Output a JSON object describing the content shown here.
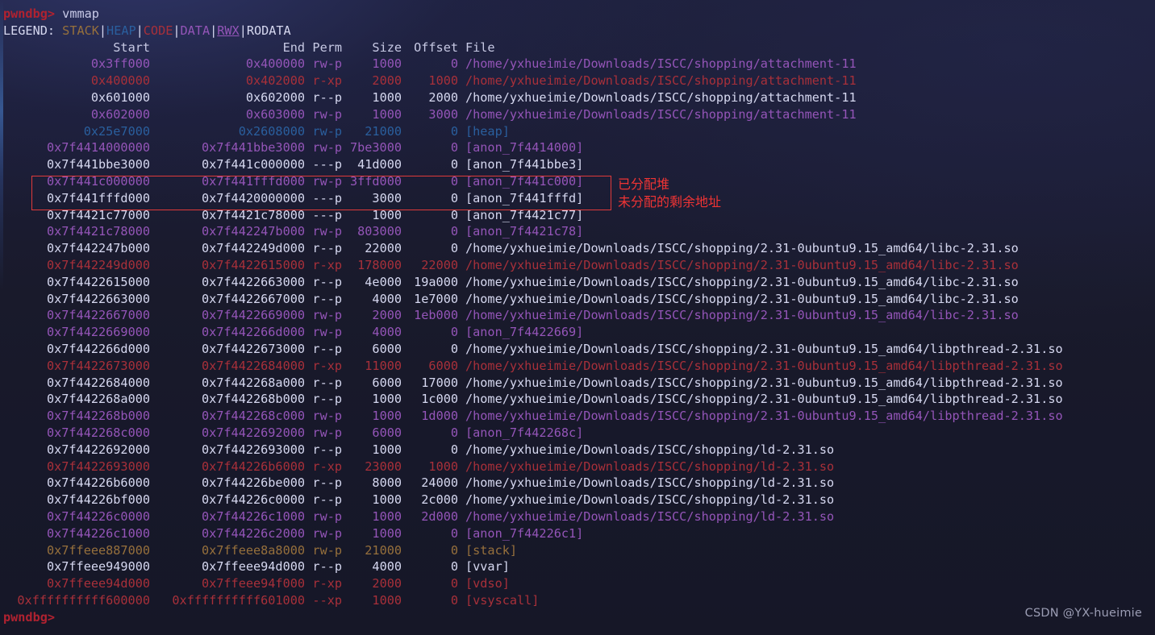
{
  "terminal": {
    "prompt": "pwndbg>",
    "command": "vmmap",
    "trailing_prompt": "pwndbg>",
    "legend": {
      "label": "LEGEND:",
      "items": [
        "STACK",
        "HEAP",
        "CODE",
        "DATA",
        "RWX",
        "RODATA"
      ],
      "separator": "|",
      "colors": {
        "STACK": "#96703c",
        "HEAP": "#2a5f9e",
        "CODE": "#a8303a",
        "DATA": "#9455b8",
        "RWX": "#9455b8",
        "RODATA": "#d6d8f0"
      }
    },
    "headers": {
      "start": "Start",
      "end": "End",
      "perm": "Perm",
      "size": "Size",
      "offset": "Offset",
      "file": "File"
    },
    "rows": [
      {
        "start": "0x3ff000",
        "end": "0x400000",
        "perm": "rw-p",
        "size": "1000",
        "offset": "0",
        "file": "/home/yxhueimie/Downloads/ISCC/shopping/attachment-11",
        "kind": "data"
      },
      {
        "start": "0x400000",
        "end": "0x402000",
        "perm": "r-xp",
        "size": "2000",
        "offset": "1000",
        "file": "/home/yxhueimie/Downloads/ISCC/shopping/attachment-11",
        "kind": "code"
      },
      {
        "start": "0x601000",
        "end": "0x602000",
        "perm": "r--p",
        "size": "1000",
        "offset": "2000",
        "file": "/home/yxhueimie/Downloads/ISCC/shopping/attachment-11",
        "kind": "rodata"
      },
      {
        "start": "0x602000",
        "end": "0x603000",
        "perm": "rw-p",
        "size": "1000",
        "offset": "3000",
        "file": "/home/yxhueimie/Downloads/ISCC/shopping/attachment-11",
        "kind": "data"
      },
      {
        "start": "0x25e7000",
        "end": "0x2608000",
        "perm": "rw-p",
        "size": "21000",
        "offset": "0",
        "file": "[heap]",
        "kind": "heap"
      },
      {
        "start": "0x7f4414000000",
        "end": "0x7f441bbe3000",
        "perm": "rw-p",
        "size": "7be3000",
        "offset": "0",
        "file": "[anon_7f4414000]",
        "kind": "data"
      },
      {
        "start": "0x7f441bbe3000",
        "end": "0x7f441c000000",
        "perm": "---p",
        "size": "41d000",
        "offset": "0",
        "file": "[anon_7f441bbe3]",
        "kind": "rodata"
      },
      {
        "start": "0x7f441c000000",
        "end": "0x7f441fffd000",
        "perm": "rw-p",
        "size": "3ffd000",
        "offset": "0",
        "file": "[anon_7f441c000]",
        "kind": "data"
      },
      {
        "start": "0x7f441fffd000",
        "end": "0x7f4420000000",
        "perm": "---p",
        "size": "3000",
        "offset": "0",
        "file": "[anon_7f441fffd]",
        "kind": "rodata"
      },
      {
        "start": "0x7f4421c77000",
        "end": "0x7f4421c78000",
        "perm": "---p",
        "size": "1000",
        "offset": "0",
        "file": "[anon_7f4421c77]",
        "kind": "rodata"
      },
      {
        "start": "0x7f4421c78000",
        "end": "0x7f442247b000",
        "perm": "rw-p",
        "size": "803000",
        "offset": "0",
        "file": "[anon_7f4421c78]",
        "kind": "data"
      },
      {
        "start": "0x7f442247b000",
        "end": "0x7f442249d000",
        "perm": "r--p",
        "size": "22000",
        "offset": "0",
        "file": "/home/yxhueimie/Downloads/ISCC/shopping/2.31-0ubuntu9.15_amd64/libc-2.31.so",
        "kind": "rodata"
      },
      {
        "start": "0x7f442249d000",
        "end": "0x7f4422615000",
        "perm": "r-xp",
        "size": "178000",
        "offset": "22000",
        "file": "/home/yxhueimie/Downloads/ISCC/shopping/2.31-0ubuntu9.15_amd64/libc-2.31.so",
        "kind": "code"
      },
      {
        "start": "0x7f4422615000",
        "end": "0x7f4422663000",
        "perm": "r--p",
        "size": "4e000",
        "offset": "19a000",
        "file": "/home/yxhueimie/Downloads/ISCC/shopping/2.31-0ubuntu9.15_amd64/libc-2.31.so",
        "kind": "rodata"
      },
      {
        "start": "0x7f4422663000",
        "end": "0x7f4422667000",
        "perm": "r--p",
        "size": "4000",
        "offset": "1e7000",
        "file": "/home/yxhueimie/Downloads/ISCC/shopping/2.31-0ubuntu9.15_amd64/libc-2.31.so",
        "kind": "rodata"
      },
      {
        "start": "0x7f4422667000",
        "end": "0x7f4422669000",
        "perm": "rw-p",
        "size": "2000",
        "offset": "1eb000",
        "file": "/home/yxhueimie/Downloads/ISCC/shopping/2.31-0ubuntu9.15_amd64/libc-2.31.so",
        "kind": "data"
      },
      {
        "start": "0x7f4422669000",
        "end": "0x7f442266d000",
        "perm": "rw-p",
        "size": "4000",
        "offset": "0",
        "file": "[anon_7f4422669]",
        "kind": "data"
      },
      {
        "start": "0x7f442266d000",
        "end": "0x7f4422673000",
        "perm": "r--p",
        "size": "6000",
        "offset": "0",
        "file": "/home/yxhueimie/Downloads/ISCC/shopping/2.31-0ubuntu9.15_amd64/libpthread-2.31.so",
        "kind": "rodata"
      },
      {
        "start": "0x7f4422673000",
        "end": "0x7f4422684000",
        "perm": "r-xp",
        "size": "11000",
        "offset": "6000",
        "file": "/home/yxhueimie/Downloads/ISCC/shopping/2.31-0ubuntu9.15_amd64/libpthread-2.31.so",
        "kind": "code"
      },
      {
        "start": "0x7f4422684000",
        "end": "0x7f442268a000",
        "perm": "r--p",
        "size": "6000",
        "offset": "17000",
        "file": "/home/yxhueimie/Downloads/ISCC/shopping/2.31-0ubuntu9.15_amd64/libpthread-2.31.so",
        "kind": "rodata"
      },
      {
        "start": "0x7f442268a000",
        "end": "0x7f442268b000",
        "perm": "r--p",
        "size": "1000",
        "offset": "1c000",
        "file": "/home/yxhueimie/Downloads/ISCC/shopping/2.31-0ubuntu9.15_amd64/libpthread-2.31.so",
        "kind": "rodata"
      },
      {
        "start": "0x7f442268b000",
        "end": "0x7f442268c000",
        "perm": "rw-p",
        "size": "1000",
        "offset": "1d000",
        "file": "/home/yxhueimie/Downloads/ISCC/shopping/2.31-0ubuntu9.15_amd64/libpthread-2.31.so",
        "kind": "data"
      },
      {
        "start": "0x7f442268c000",
        "end": "0x7f4422692000",
        "perm": "rw-p",
        "size": "6000",
        "offset": "0",
        "file": "[anon_7f442268c]",
        "kind": "data"
      },
      {
        "start": "0x7f4422692000",
        "end": "0x7f4422693000",
        "perm": "r--p",
        "size": "1000",
        "offset": "0",
        "file": "/home/yxhueimie/Downloads/ISCC/shopping/ld-2.31.so",
        "kind": "rodata"
      },
      {
        "start": "0x7f4422693000",
        "end": "0x7f44226b6000",
        "perm": "r-xp",
        "size": "23000",
        "offset": "1000",
        "file": "/home/yxhueimie/Downloads/ISCC/shopping/ld-2.31.so",
        "kind": "code"
      },
      {
        "start": "0x7f44226b6000",
        "end": "0x7f44226be000",
        "perm": "r--p",
        "size": "8000",
        "offset": "24000",
        "file": "/home/yxhueimie/Downloads/ISCC/shopping/ld-2.31.so",
        "kind": "rodata"
      },
      {
        "start": "0x7f44226bf000",
        "end": "0x7f44226c0000",
        "perm": "r--p",
        "size": "1000",
        "offset": "2c000",
        "file": "/home/yxhueimie/Downloads/ISCC/shopping/ld-2.31.so",
        "kind": "rodata"
      },
      {
        "start": "0x7f44226c0000",
        "end": "0x7f44226c1000",
        "perm": "rw-p",
        "size": "1000",
        "offset": "2d000",
        "file": "/home/yxhueimie/Downloads/ISCC/shopping/ld-2.31.so",
        "kind": "data"
      },
      {
        "start": "0x7f44226c1000",
        "end": "0x7f44226c2000",
        "perm": "rw-p",
        "size": "1000",
        "offset": "0",
        "file": "[anon_7f44226c1]",
        "kind": "data"
      },
      {
        "start": "0x7ffeee887000",
        "end": "0x7ffeee8a8000",
        "perm": "rw-p",
        "size": "21000",
        "offset": "0",
        "file": "[stack]",
        "kind": "stack"
      },
      {
        "start": "0x7ffeee949000",
        "end": "0x7ffeee94d000",
        "perm": "r--p",
        "size": "4000",
        "offset": "0",
        "file": "[vvar]",
        "kind": "rodata"
      },
      {
        "start": "0x7ffeee94d000",
        "end": "0x7ffeee94f000",
        "perm": "r-xp",
        "size": "2000",
        "offset": "0",
        "file": "[vdso]",
        "kind": "code"
      },
      {
        "start": "0xffffffffff600000",
        "end": "0xffffffffff601000",
        "perm": "--xp",
        "size": "1000",
        "offset": "0",
        "file": "[vsyscall]",
        "kind": "code"
      }
    ]
  },
  "annotations": {
    "box_color": "#e03a3a",
    "labels": [
      {
        "text": "已分配堆"
      },
      {
        "text": "未分配的剩余地址"
      }
    ]
  },
  "watermark": {
    "text": "CSDN @YX-hueimie"
  }
}
